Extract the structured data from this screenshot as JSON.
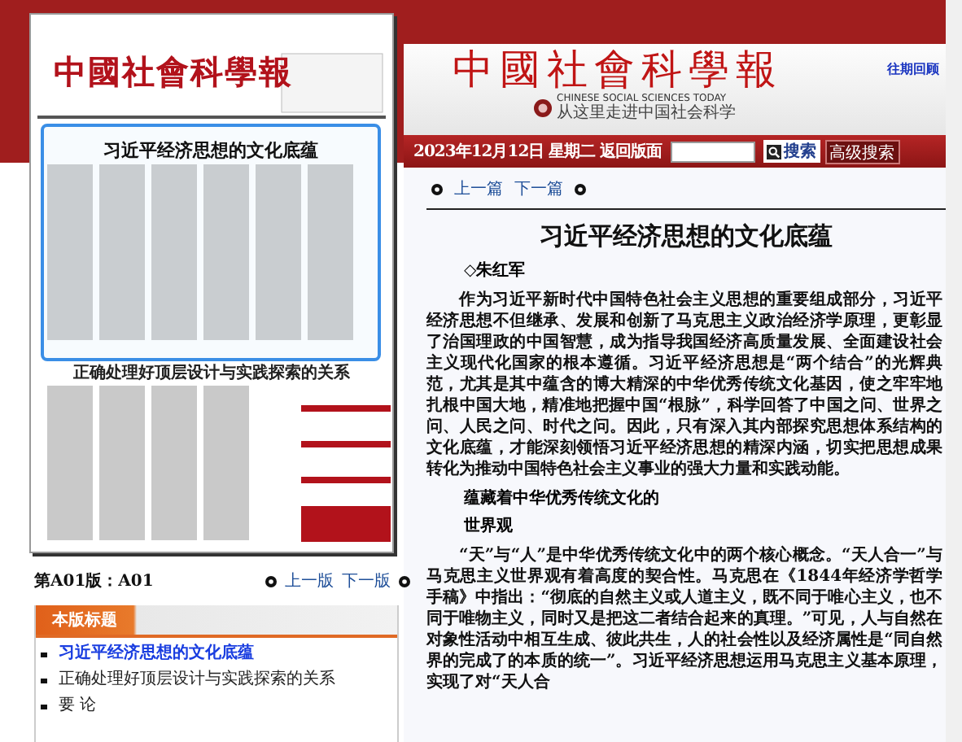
{
  "edition_preview": {
    "masthead": "中國社會科學報",
    "headline": "习近平经济思想的文化底蕴",
    "second_headline": "正确处理好顶层设计与实践探索的关系"
  },
  "edition_nav": {
    "label": "第A01版：A01",
    "prev": "上一版",
    "next": "下一版"
  },
  "headlines_panel": {
    "title": "本版标题",
    "items": [
      {
        "text": "习近平经济思想的文化底蕴",
        "selected": true
      },
      {
        "text": "正确处理好顶层设计与实践探索的关系",
        "selected": false
      },
      {
        "text": "要 论",
        "selected": false
      }
    ]
  },
  "header": {
    "logo": "中國社會科學報",
    "english": "CHINESE SOCIAL SCIENCES TODAY",
    "slogan": "从这里走进中国社会科学",
    "archive_link": "往期回顾"
  },
  "search_bar": {
    "date": "2023年12月12日 星期二",
    "back_link": "返回版面",
    "search_button": "搜索",
    "advanced_button": "高级搜索"
  },
  "article_nav": {
    "prev": "上一篇",
    "next": "下一篇"
  },
  "article": {
    "title": "习近平经济思想的文化底蕴",
    "author": "◇朱红军",
    "blocks": [
      {
        "kind": "paragraph",
        "text": "作为习近平新时代中国特色社会主义思想的重要组成部分，习近平经济思想不但继承、发展和创新了马克思主义政治经济学原理，更彰显了治国理政的中国智慧，成为指导我国经济高质量发展、全面建设社会主义现代化国家的根本遵循。习近平经济思想是“两个结合”的光辉典范，尤其是其中蕴含的博大精深的中华优秀传统文化基因，使之牢牢地扎根中国大地，精准地把握中国“根脉”，科学回答了中国之问、世界之问、人民之问、时代之问。因此，只有深入其内部探究思想体系结构的文化底蕴，才能深刻领悟习近平经济思想的精深内涵，切实把思想成果转化为推动中国特色社会主义事业的强大力量和实践动能。"
      },
      {
        "kind": "subhead",
        "text": "蕴藏着中华优秀传统文化的"
      },
      {
        "kind": "subhead",
        "text": "世界观"
      },
      {
        "kind": "paragraph",
        "text": "“天”与“人”是中华优秀传统文化中的两个核心概念。“天人合一”与马克思主义世界观有着高度的契合性。马克思在《1844年经济学哲学手稿》中指出：“彻底的自然主义或人道主义，既不同于唯心主义，也不同于唯物主义，同时又是把这二者结合起来的真理。”可见，人与自然在对象性活动中相互生成、彼此共生，人的社会性以及经济属性是“同自然界的完成了的本质的统一”。习近平经济思想运用马克思主义基本原理，实现了对“天人合"
      }
    ]
  }
}
